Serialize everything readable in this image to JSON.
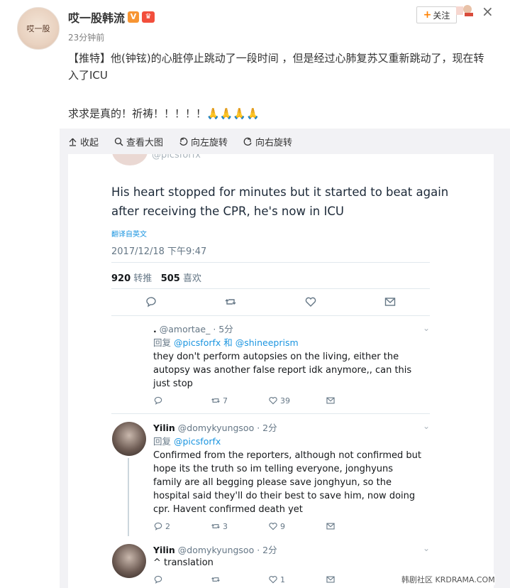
{
  "header": {
    "username": "哎一股韩流",
    "verified_badge": "V",
    "member_badge": "♛",
    "time": "23分钟前",
    "follow_label": "关注",
    "close_icon": "×"
  },
  "post": {
    "line1": "【推特】他(钟铉)的心脏停止跳动了一段时间 ，但是经过心肺复苏又重新跳动了，现在转入了ICU",
    "line2": "求求是真的！祈祷！！！！！🙏🙏🙏🙏"
  },
  "toolbar": {
    "collapse": "收起",
    "view_large": "查看大图",
    "rotate_left": "向左旋转",
    "rotate_right": "向右旋转"
  },
  "tweet": {
    "handle_top": "@picsforfx",
    "text": "His heart stopped for minutes but it started to beat again after receiving the CPR, he's now in ICU",
    "translate": "翻译自英文",
    "date": "2017/12/18 下午9:47",
    "retweets_count": "920",
    "retweets_label": "转推",
    "likes_count": "505",
    "likes_label": "喜欢"
  },
  "replies": [
    {
      "name": ".",
      "handle": "@amortae_ · 5分",
      "reply_prefix": "回复",
      "reply_to": "@picsforfx 和 @shineeprism",
      "body": "they don't perform autopsies on the living, either the autopsy was another false report idk anymore,, can this just stop",
      "retweets": "7",
      "likes": "39"
    },
    {
      "name": "Yilin",
      "handle": "@domykyungsoo · 2分",
      "reply_prefix": "回复",
      "reply_to": "@picsforfx",
      "body": "Confirmed from the reporters, although not confirmed but hope its the truth so im telling everyone, jonghyuns family are all begging please save jonghyun, so the hospital said they'll do their best to save him, now doing cpr. Havent confirmed death yet",
      "comments": "2",
      "retweets": "3",
      "likes": "9"
    },
    {
      "name": "Yilin",
      "handle": "@domykyungsoo · 2分",
      "body": "^ translation",
      "likes": "1"
    }
  ],
  "watermark": "韩剧社区 KRDRAMA.COM",
  "colors": {
    "accent_orange": "#ff8200",
    "twitter_blue": "#1b95e0",
    "muted": "#657786"
  }
}
